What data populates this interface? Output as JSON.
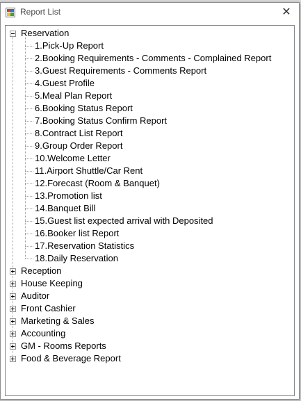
{
  "window": {
    "title": "Report List",
    "close_glyph": "✕"
  },
  "tree": {
    "root_expanded": {
      "label": "Reservation",
      "children": [
        "1.Pick-Up Report",
        "2.Booking Requirements - Comments - Complained Report",
        "3.Guest Requirements - Comments Report",
        "4.Guest Profile",
        "5.Meal Plan Report",
        "6.Booking Status Report",
        "7.Booking Status Confirm Report",
        "8.Contract List Report",
        "9.Group Order Report",
        "10.Welcome Letter",
        "11.Airport Shuttle/Car Rent",
        "12.Forecast (Room & Banquet)",
        "13.Promotion list",
        "14.Banquet Bill",
        "15.Guest list expected arrival with Deposited",
        "16.Booker list Report",
        "17.Reservation Statistics",
        "18.Daily Reservation"
      ]
    },
    "collapsed": [
      "Reception",
      "House Keeping",
      "Auditor",
      "Front Cashier",
      "Marketing & Sales",
      "Accounting",
      "GM - Rooms Reports",
      "Food & Beverage Report"
    ]
  }
}
